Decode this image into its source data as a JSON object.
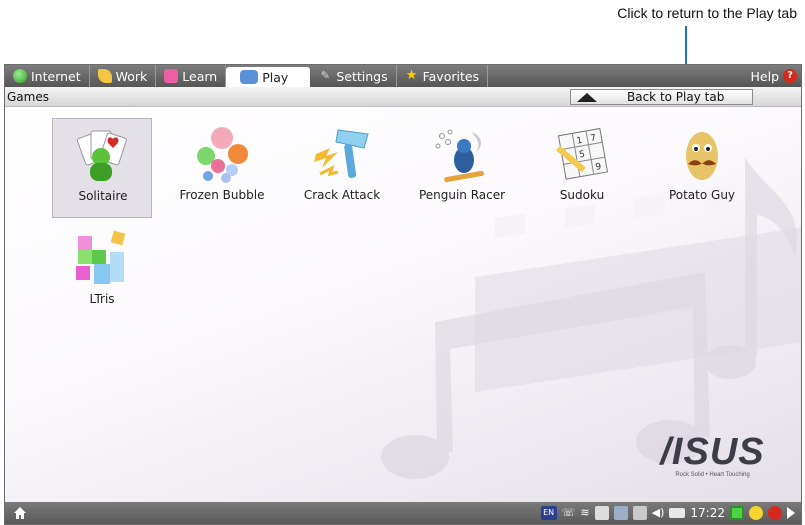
{
  "callout": {
    "text": "Click to return to the Play tab"
  },
  "tabs": [
    {
      "label": "Internet",
      "icon": "internet-icon"
    },
    {
      "label": "Work",
      "icon": "work-icon"
    },
    {
      "label": "Learn",
      "icon": "learn-icon"
    },
    {
      "label": "Play",
      "icon": "play-icon",
      "active": true
    },
    {
      "label": "Settings",
      "icon": "settings-icon"
    },
    {
      "label": "Favorites",
      "icon": "favorites-icon"
    }
  ],
  "help": {
    "label": "Help",
    "icon_glyph": "?"
  },
  "section": {
    "title": "Games"
  },
  "back_button": {
    "label": "Back to Play tab"
  },
  "apps": [
    {
      "label": "Solitaire",
      "icon": "solitaire-icon",
      "selected": true
    },
    {
      "label": "Frozen Bubble",
      "icon": "frozen-bubble-icon"
    },
    {
      "label": "Crack Attack",
      "icon": "crack-attack-icon"
    },
    {
      "label": "Penguin Racer",
      "icon": "penguin-racer-icon"
    },
    {
      "label": "Sudoku",
      "icon": "sudoku-icon"
    },
    {
      "label": "Potato Guy",
      "icon": "potato-guy-icon"
    },
    {
      "label": "LTris",
      "icon": "ltris-icon"
    }
  ],
  "brand": {
    "logo": "/ISUS",
    "tagline": "Rock Solid • Heart Touching"
  },
  "taskbar": {
    "input_method": "EN",
    "clock": "17:22"
  },
  "colors": {
    "accent_blue": "#1e73be",
    "tab_bar": "#666666",
    "selected_tile": "#e4e0e8"
  }
}
